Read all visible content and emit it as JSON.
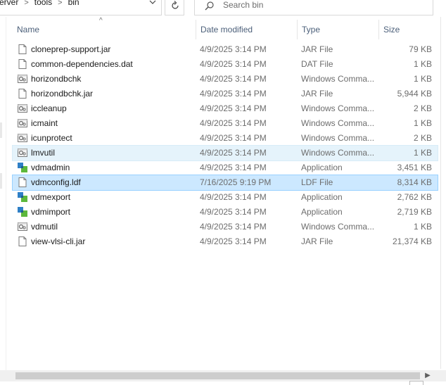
{
  "address": {
    "crumbs": [
      "erver",
      "tools",
      "bin"
    ],
    "separator": ">",
    "dropdown_icon": "chevron-down-icon",
    "refresh_icon": "refresh-icon"
  },
  "search": {
    "placeholder": "Search bin",
    "icon": "search-icon"
  },
  "columns": {
    "name": "Name",
    "date": "Date modified",
    "type": "Type",
    "size": "Size",
    "sort_indicator": "^"
  },
  "files": [
    {
      "name": "cloneprep-support.jar",
      "date": "4/9/2025 3:14 PM",
      "type": "JAR File",
      "size": "79 KB",
      "icon": "file-icon"
    },
    {
      "name": "common-dependencies.dat",
      "date": "4/9/2025 3:14 PM",
      "type": "DAT File",
      "size": "1 KB",
      "icon": "file-icon"
    },
    {
      "name": "horizondbchk",
      "date": "4/9/2025 3:14 PM",
      "type": "Windows Comma...",
      "size": "1 KB",
      "icon": "batch-file-icon"
    },
    {
      "name": "horizondbchk.jar",
      "date": "4/9/2025 3:14 PM",
      "type": "JAR File",
      "size": "5,944 KB",
      "icon": "file-icon"
    },
    {
      "name": "iccleanup",
      "date": "4/9/2025 3:14 PM",
      "type": "Windows Comma...",
      "size": "2 KB",
      "icon": "batch-file-icon"
    },
    {
      "name": "icmaint",
      "date": "4/9/2025 3:14 PM",
      "type": "Windows Comma...",
      "size": "1 KB",
      "icon": "batch-file-icon"
    },
    {
      "name": "icunprotect",
      "date": "4/9/2025 3:14 PM",
      "type": "Windows Comma...",
      "size": "2 KB",
      "icon": "batch-file-icon"
    },
    {
      "name": "lmvutil",
      "date": "4/9/2025 3:14 PM",
      "type": "Windows Comma...",
      "size": "1 KB",
      "icon": "batch-file-icon",
      "state": "hover"
    },
    {
      "name": "vdmadmin",
      "date": "4/9/2025 3:14 PM",
      "type": "Application",
      "size": "3,451 KB",
      "icon": "application-icon"
    },
    {
      "name": "vdmconfig.ldf",
      "date": "7/16/2025 9:19 PM",
      "type": "LDF File",
      "size": "8,314 KB",
      "icon": "file-icon",
      "state": "selected"
    },
    {
      "name": "vdmexport",
      "date": "4/9/2025 3:14 PM",
      "type": "Application",
      "size": "2,762 KB",
      "icon": "application-icon"
    },
    {
      "name": "vdmimport",
      "date": "4/9/2025 3:14 PM",
      "type": "Application",
      "size": "2,719 KB",
      "icon": "application-icon"
    },
    {
      "name": "vdmutil",
      "date": "4/9/2025 3:14 PM",
      "type": "Windows Comma...",
      "size": "1 KB",
      "icon": "batch-file-icon"
    },
    {
      "name": "view-vlsi-cli.jar",
      "date": "4/9/2025 3:14 PM",
      "type": "JAR File",
      "size": "21,374 KB",
      "icon": "file-icon"
    }
  ],
  "colors": {
    "selected": "#cce8ff",
    "hover": "#e5f3fb",
    "header_text": "#4c607a",
    "secondary_text": "#6d6d6d"
  }
}
